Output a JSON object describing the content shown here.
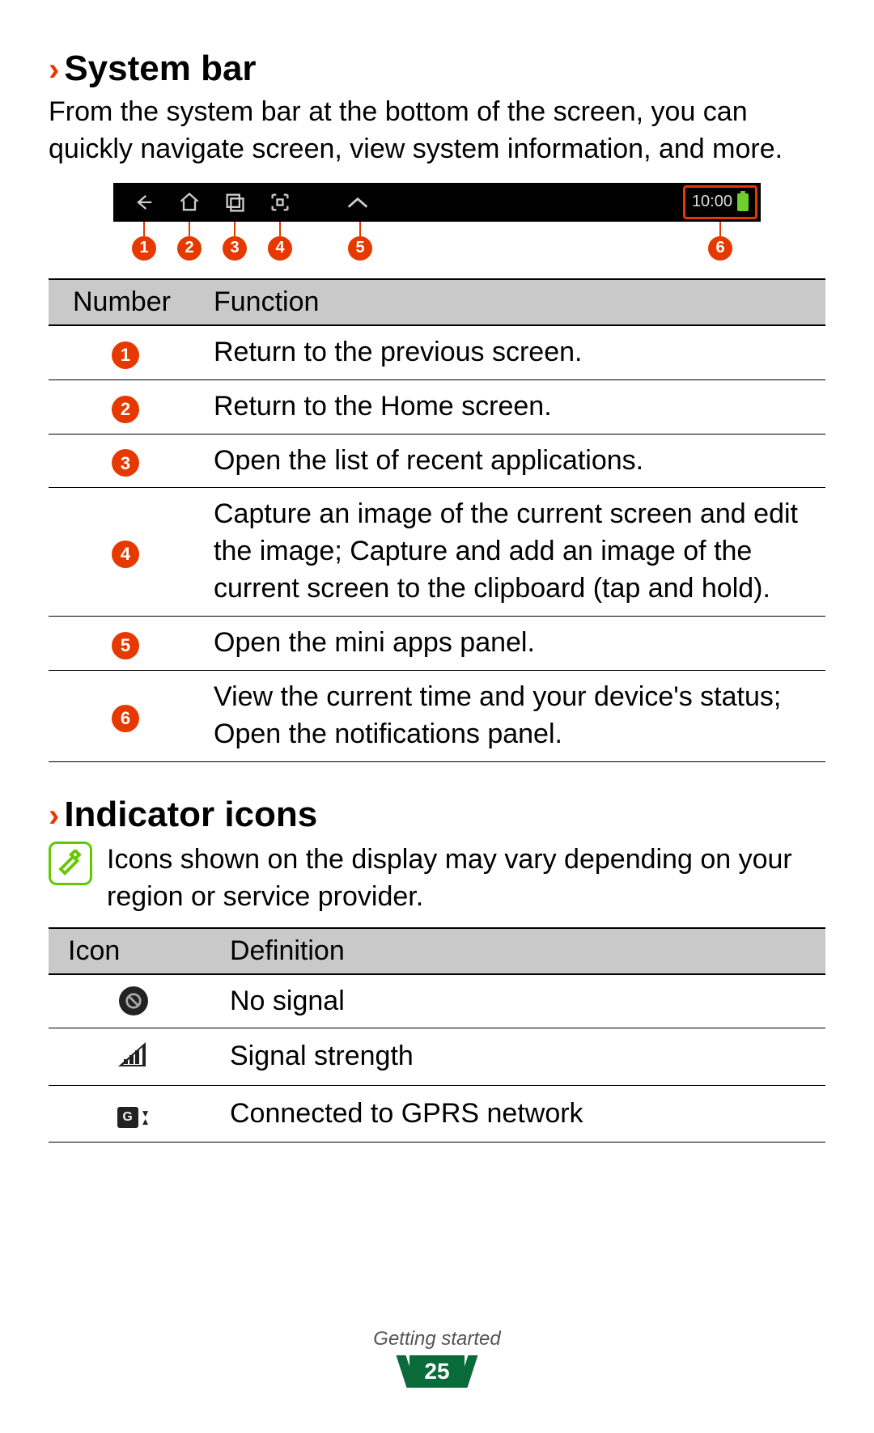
{
  "section1": {
    "heading": "System bar",
    "desc": "From the system bar at the bottom of the screen, you can quickly navigate screen, view system information, and more.",
    "status_time": "10:00",
    "table": {
      "head_number": "Number",
      "head_function": "Function",
      "rows": [
        {
          "num": "1",
          "func": "Return to the previous screen."
        },
        {
          "num": "2",
          "func": "Return to the Home screen."
        },
        {
          "num": "3",
          "func": "Open the list of recent applications."
        },
        {
          "num": "4",
          "func": "Capture an image of the current screen and edit the image; Capture and add an image of the current screen to the clipboard (tap and hold)."
        },
        {
          "num": "5",
          "func": "Open the mini apps panel."
        },
        {
          "num": "6",
          "func": "View the current time and your device's status; Open the notifications panel."
        }
      ]
    }
  },
  "section2": {
    "heading": "Indicator icons",
    "note": "Icons shown on the display may vary depending on your region or service provider.",
    "table": {
      "head_icon": "Icon",
      "head_def": "Definition",
      "rows": [
        {
          "icon": "no-signal",
          "def": "No signal"
        },
        {
          "icon": "signal-strength",
          "def": "Signal strength"
        },
        {
          "icon": "gprs",
          "def": "Connected to GPRS network"
        }
      ]
    }
  },
  "footer": {
    "chapter": "Getting started",
    "page": "25"
  },
  "gprs_label": "G"
}
